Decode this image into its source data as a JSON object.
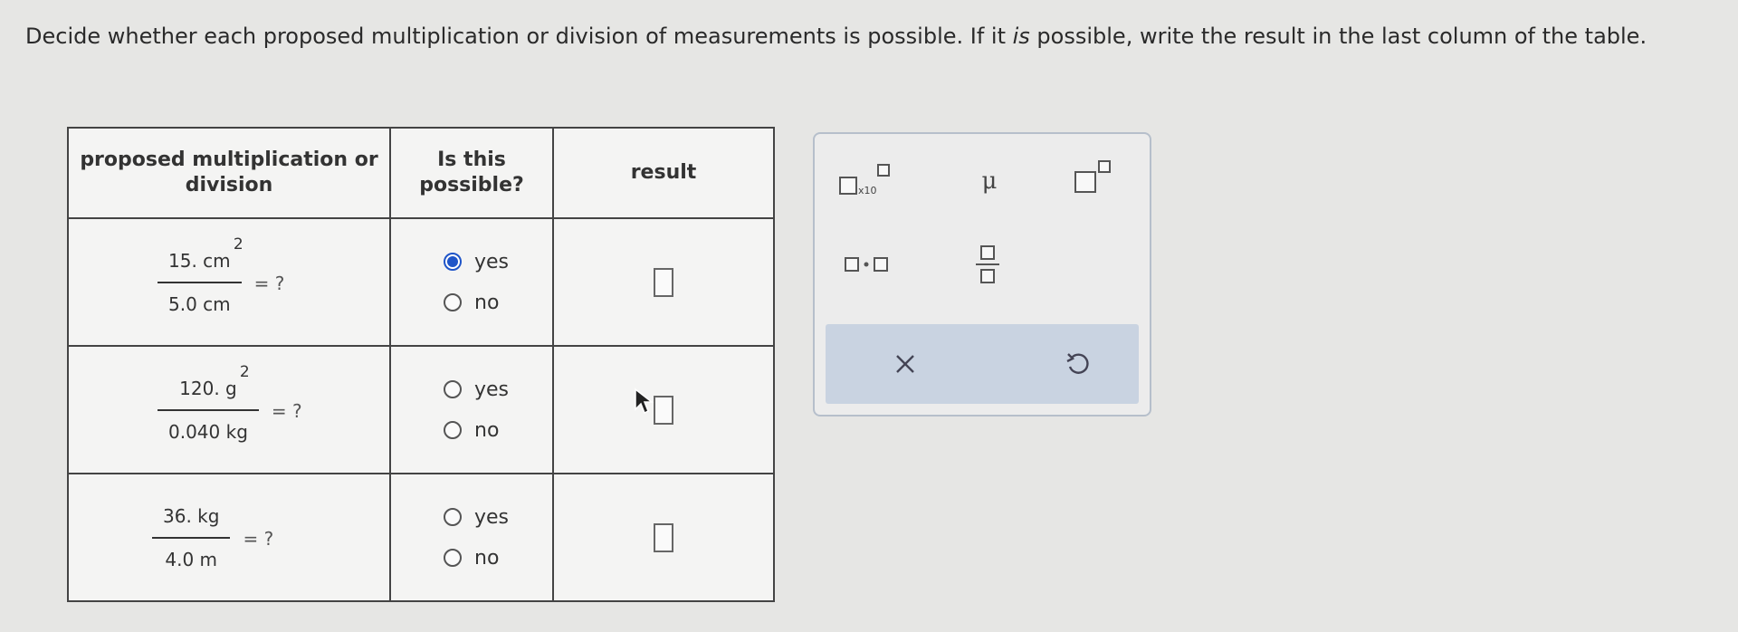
{
  "instructions": {
    "part1": "Decide whether each proposed multiplication or division of measurements is possible. If it ",
    "emphasis": "is",
    "part2": " possible, write the result in the last column of the table."
  },
  "table": {
    "headers": {
      "col1": "proposed multiplication or division",
      "col2": "Is this possible?",
      "col3": "result"
    },
    "rows": [
      {
        "numerator": "15. cm",
        "num_exp": "2",
        "denominator": "5.0 cm",
        "equals": "= ?",
        "yes": "yes",
        "no": "no",
        "selected": "yes"
      },
      {
        "numerator": "120. g",
        "num_exp": "2",
        "denominator": "0.040 kg",
        "equals": "= ?",
        "yes": "yes",
        "no": "no",
        "selected": ""
      },
      {
        "numerator": "36. kg",
        "num_exp": "",
        "denominator": "4.0 m",
        "equals": "= ?",
        "yes": "yes",
        "no": "no",
        "selected": ""
      }
    ]
  },
  "palette": {
    "sci_notation_label": "x10",
    "mu_symbol": "μ",
    "icons": [
      "scientific-notation-icon",
      "mu-icon",
      "superscript-icon",
      "multiply-dot-icon",
      "fraction-icon",
      "clear-icon",
      "undo-icon"
    ]
  },
  "colors": {
    "accent": "#1f55c8",
    "palette_bar": "#c9d3e1"
  }
}
